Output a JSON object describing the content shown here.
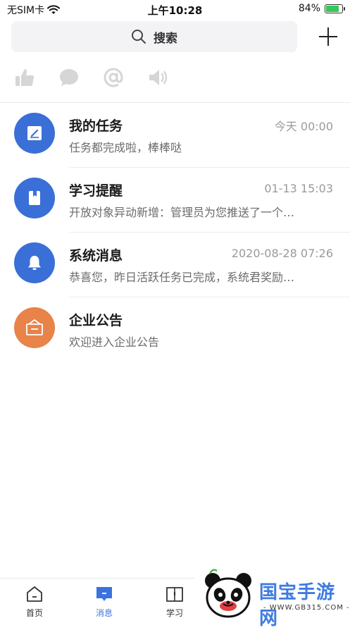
{
  "status": {
    "carrier": "无SIM卡",
    "time": "上午10:28",
    "battery_pct": "84%",
    "battery_level": 0.84
  },
  "search": {
    "label": "搜索",
    "icon": "search-icon"
  },
  "quick_actions": [
    {
      "name": "thumbs-up-icon"
    },
    {
      "name": "chat-bubble-icon"
    },
    {
      "name": "at-sign-icon"
    },
    {
      "name": "speaker-icon"
    }
  ],
  "messages": [
    {
      "title": "我的任务",
      "time": "今天 00:00",
      "preview": "任务都完成啦，棒棒哒",
      "color": "#3a6fd8",
      "icon": "task-edit-icon"
    },
    {
      "title": "学习提醒",
      "time": "01-13 15:03",
      "preview": "开放对象异动新增：管理员为您推送了一个…",
      "color": "#3a6fd8",
      "icon": "book-icon"
    },
    {
      "title": "系统消息",
      "time": "2020-08-28 07:26",
      "preview": "恭喜您，昨日活跃任务已完成，系统君奖励…",
      "color": "#3a6fd8",
      "icon": "bell-icon"
    },
    {
      "title": "企业公告",
      "time": "",
      "preview": "欢迎进入企业公告",
      "color": "#e8834a",
      "icon": "announcement-icon"
    }
  ],
  "tabs": [
    {
      "label": "首页",
      "icon": "home-icon"
    },
    {
      "label": "消息",
      "icon": "message-icon",
      "active": true
    },
    {
      "label": "学习",
      "icon": "study-book-icon"
    }
  ],
  "watermark": {
    "title": "国宝手游网",
    "subtitle": "- WWW.GB315.COM -"
  },
  "colors": {
    "accent": "#3a73e0",
    "orange": "#e8834a",
    "icon_gray": "#d6d6d6"
  }
}
